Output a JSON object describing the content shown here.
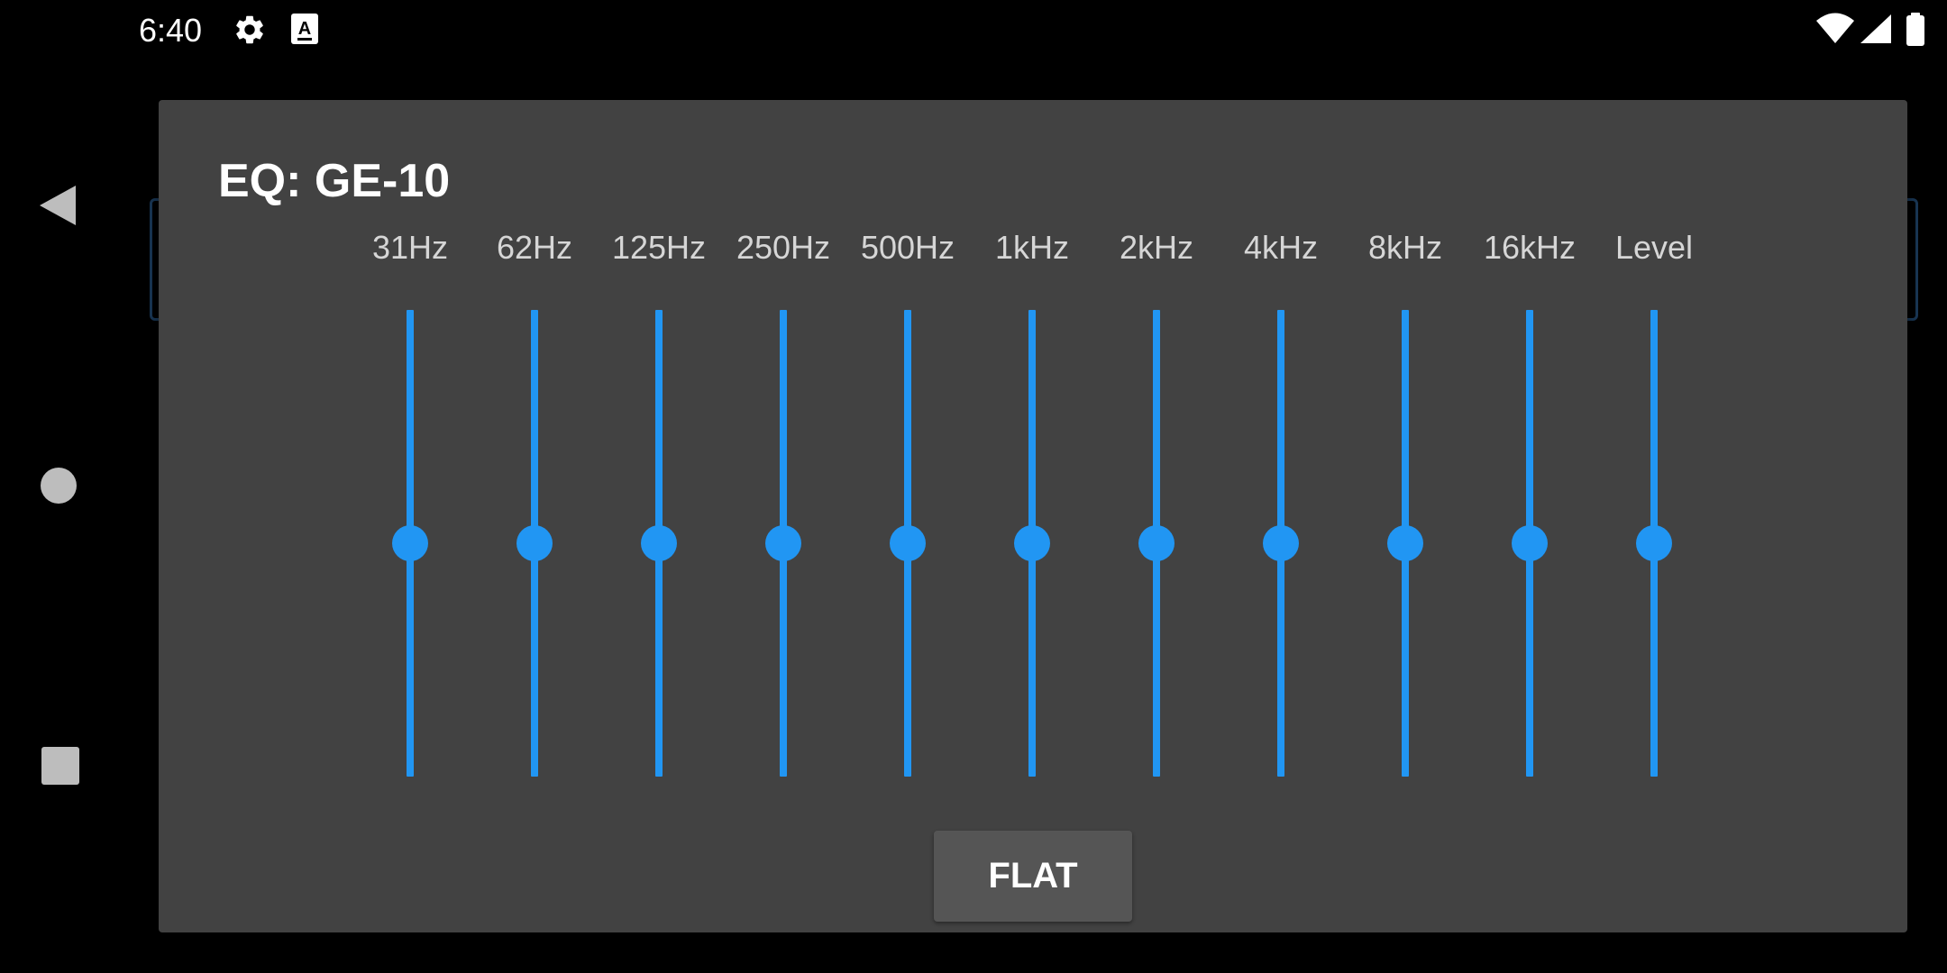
{
  "status_bar": {
    "time": "6:40",
    "icons": [
      "settings-gear-icon",
      "keyboard-a-icon",
      "wifi-icon",
      "cell-signal-icon",
      "battery-icon"
    ]
  },
  "nav_bar": {
    "icons": [
      "back-triangle-icon",
      "home-circle-icon",
      "recents-square-icon"
    ]
  },
  "dialog": {
    "title": "EQ: GE-10",
    "bands": [
      {
        "label": "31Hz",
        "level": 0.5
      },
      {
        "label": "62Hz",
        "level": 0.5
      },
      {
        "label": "125Hz",
        "level": 0.5
      },
      {
        "label": "250Hz",
        "level": 0.5
      },
      {
        "label": "500Hz",
        "level": 0.5
      },
      {
        "label": "1kHz",
        "level": 0.5
      },
      {
        "label": "2kHz",
        "level": 0.5
      },
      {
        "label": "4kHz",
        "level": 0.5
      },
      {
        "label": "8kHz",
        "level": 0.5
      },
      {
        "label": "16kHz",
        "level": 0.5
      },
      {
        "label": "Level",
        "level": 0.5
      }
    ],
    "flat_button_label": "FLAT"
  },
  "colors": {
    "accent": "#2196f3",
    "dialog_bg": "#424242",
    "button_bg": "#555555",
    "screen_bg": "#000000"
  }
}
